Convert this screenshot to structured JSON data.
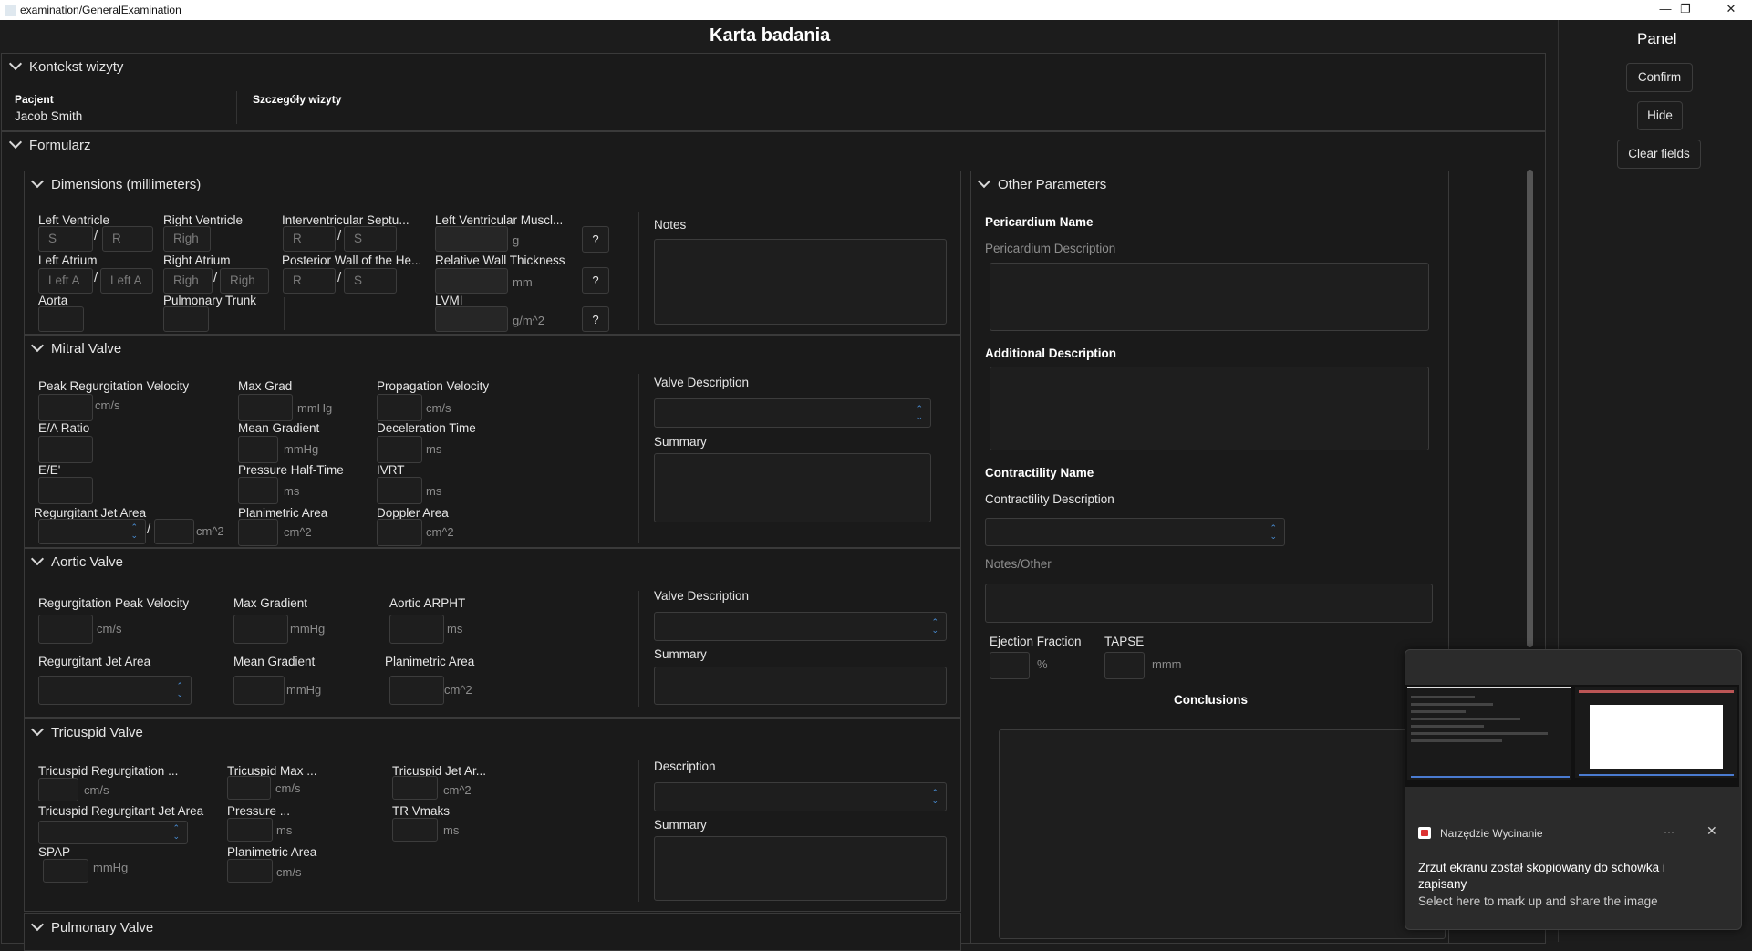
{
  "window": {
    "title": "examination/GeneralExamination"
  },
  "page": {
    "title": "Karta badania"
  },
  "panel": {
    "title": "Panel",
    "confirm": "Confirm",
    "hide": "Hide",
    "clear": "Clear fields"
  },
  "context": {
    "title": "Kontekst wizyty",
    "patient_label": "Pacjent",
    "patient_name": "Jacob Smith",
    "details_label": "Szczegóły wizyty"
  },
  "form": {
    "title": "Formularz"
  },
  "dimensions": {
    "title": "Dimensions (millimeters)",
    "left_ventricle": "Left Ventricle",
    "lv_s": "S",
    "lv_r": "R",
    "right_ventricle": "Right Ventricle",
    "rv_ph": "Righ",
    "ivs": "Interventricular Septu...",
    "ivs_r": "R",
    "ivs_s": "S",
    "lv_mass": "Left Ventricular Muscl...",
    "lv_mass_unit": "g",
    "left_atrium": "Left Atrium",
    "la_a": "Left A",
    "la_b": "Left A",
    "right_atrium": "Right Atrium",
    "ra_a": "Righ",
    "ra_b": "Righ",
    "pw": "Posterior Wall of the He...",
    "pw_r": "R",
    "pw_s": "S",
    "rwt": "Relative Wall Thickness",
    "rwt_unit": "mm",
    "aorta": "Aorta",
    "pulmonary_trunk": "Pulmonary Trunk",
    "lvmi": "LVMI",
    "lvmi_unit": "g/m^2",
    "help": "?",
    "notes": "Notes"
  },
  "mitral": {
    "title": "Mitral Valve",
    "prv": "Peak Regurgitation Velocity",
    "prv_unit": "cm/s",
    "max_grad": "Max Grad",
    "max_grad_unit": "mmHg",
    "prop_vel": "Propagation Velocity",
    "prop_vel_unit": "cm/s",
    "ea": "E/A Ratio",
    "mean_grad": "Mean Gradient",
    "mean_grad_unit": "mmHg",
    "decel": "Deceleration Time",
    "decel_unit": "ms",
    "ee": "E/E'",
    "pht": "Pressure Half-Time",
    "pht_unit": "ms",
    "ivrt": "IVRT",
    "ivrt_unit": "ms",
    "rja": "Regurgitant Jet Area",
    "rja_unit": "cm^2",
    "plan": "Planimetric Area",
    "plan_unit": "cm^2",
    "doppler": "Doppler Area",
    "doppler_unit": "cm^2",
    "valve_desc": "Valve Description",
    "summary": "Summary"
  },
  "aortic": {
    "title": "Aortic Valve",
    "rpv": "Regurgitation Peak Velocity",
    "rpv_unit": "cm/s",
    "max_grad": "Max Gradient",
    "max_grad_unit": "mmHg",
    "arpht": "Aortic ARPHT",
    "arpht_unit": "ms",
    "rja": "Regurgitant Jet Area",
    "mean_grad": "Mean Gradient",
    "mean_grad_unit": "mmHg",
    "plan": "Planimetric Area",
    "plan_unit": "cm^2",
    "valve_desc": "Valve Description",
    "summary": "Summary"
  },
  "tricuspid": {
    "title": "Tricuspid Valve",
    "trv": "Tricuspid Regurgitation ...",
    "trv_unit": "cm/s",
    "tmax": "Tricuspid Max ...",
    "tmax_unit": "cm/s",
    "tja": "Tricuspid Jet Ar...",
    "tja_unit": "cm^2",
    "trja": "Tricuspid Regurgitant Jet Area",
    "pressure": "Pressure ...",
    "pressure_unit": "ms",
    "vmaks": "TR Vmaks",
    "vmaks_unit": "ms",
    "spap": "SPAP",
    "spap_unit": "mmHg",
    "plan": "Planimetric Area",
    "plan_unit": "cm/s",
    "desc": "Description",
    "summary": "Summary"
  },
  "pulmonary": {
    "title": "Pulmonary Valve"
  },
  "other": {
    "title": "Other Parameters",
    "pericardium_name": "Pericardium Name",
    "pericardium_desc": "Pericardium Description",
    "additional_desc": "Additional Description",
    "contractility_name": "Contractility Name",
    "contractility_desc": "Contractility Description",
    "notes_other": "Notes/Other",
    "ef": "Ejection Fraction",
    "ef_unit": "%",
    "tapse": "TAPSE",
    "tapse_unit": "mmm",
    "conclusions": "Conclusions"
  },
  "toast": {
    "app": "Narzędzie Wycinanie",
    "more": "···",
    "message": "Zrzut ekranu został skopiowany do schowka i zapisany",
    "hint": "Select here to mark up and share the image"
  }
}
